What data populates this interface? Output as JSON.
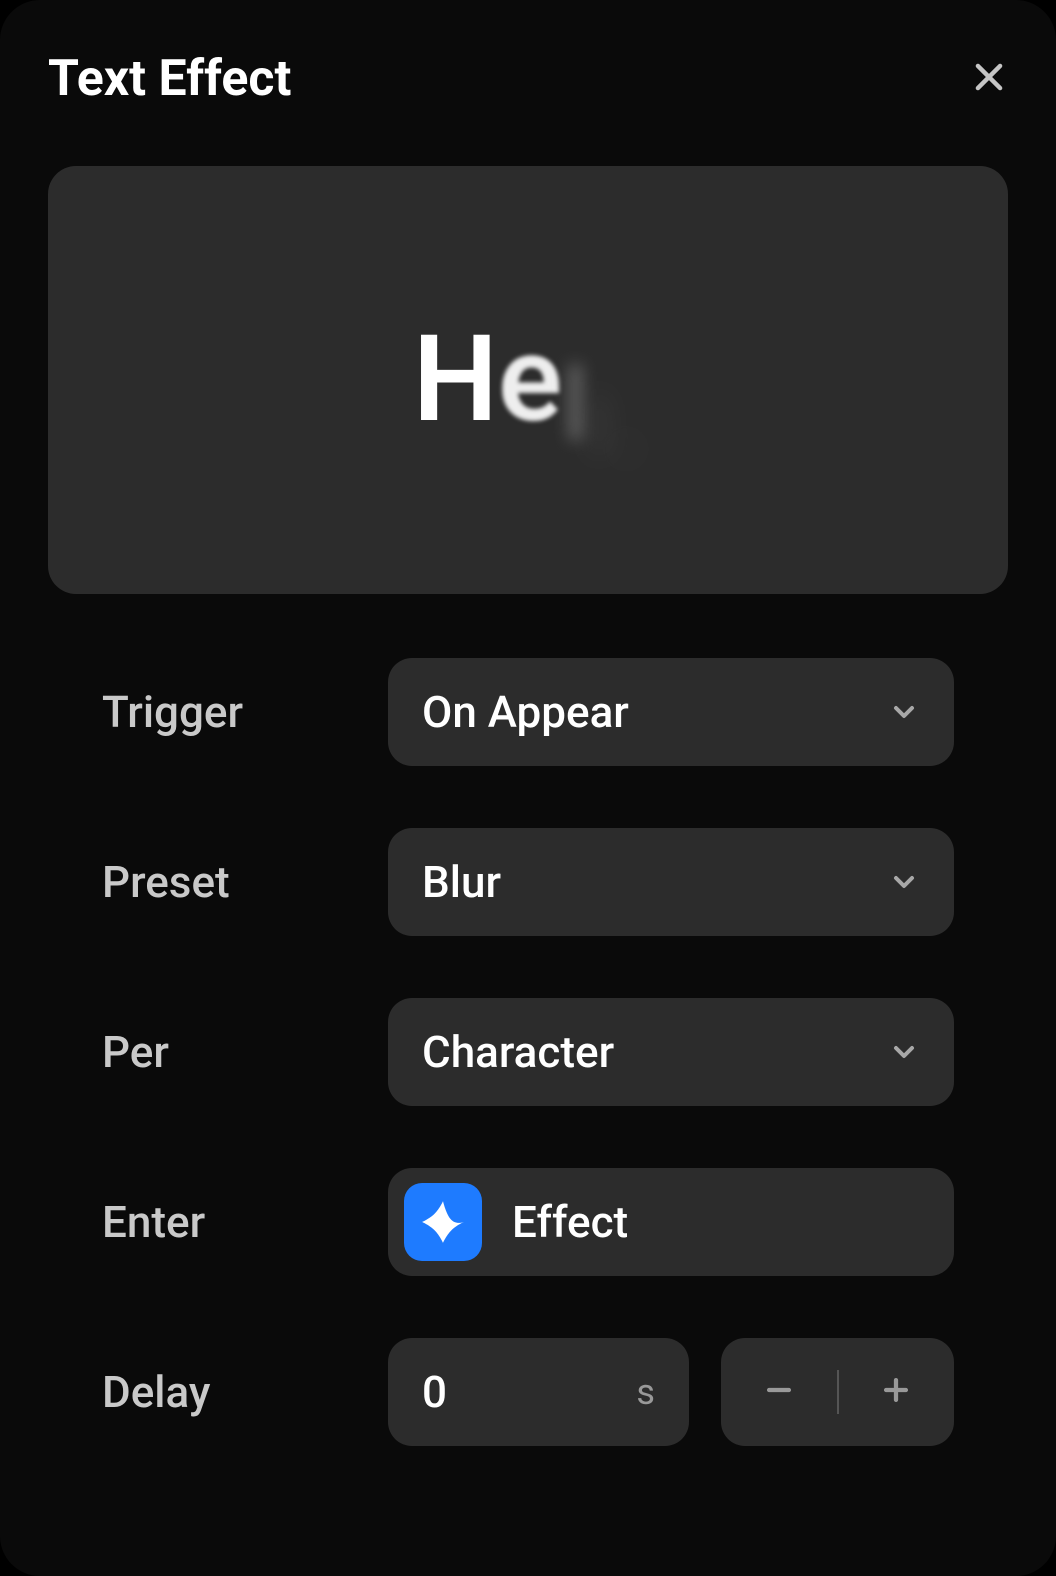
{
  "title": "Text Effect",
  "preview": {
    "text": "Hello"
  },
  "fields": {
    "trigger": {
      "label": "Trigger",
      "value": "On Appear"
    },
    "preset": {
      "label": "Preset",
      "value": "Blur"
    },
    "per": {
      "label": "Per",
      "value": "Character"
    },
    "enter": {
      "label": "Enter",
      "value": "Effect"
    },
    "delay": {
      "label": "Delay",
      "value": "0",
      "unit": "s"
    }
  },
  "colors": {
    "accent": "#1e7bff",
    "panel_bg": "#0a0a0a",
    "control_bg": "#2c2c2c"
  }
}
